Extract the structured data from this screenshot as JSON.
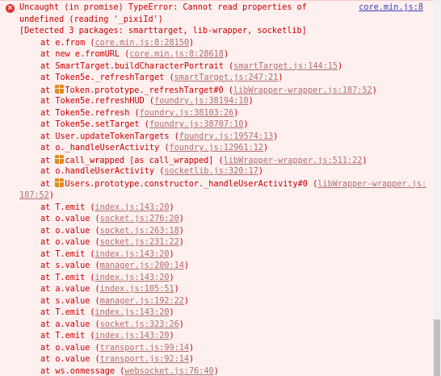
{
  "console": {
    "error_icon": "error-x-icon",
    "source_link": "core.min.js:8",
    "header_line1": "Uncaught (in promise) TypeError: Cannot read properties of",
    "header_line2": "undefined (reading '_pixiId')",
    "detected": "[Detected 3 packages: smarttarget, lib-wrapper, socketlib]",
    "frames": [
      {
        "pre": "at e.from (",
        "ref": "core.min.js:8:28150",
        "post": ")",
        "pkg": false
      },
      {
        "pre": "at new e.fromURL (",
        "ref": "core.min.js:8:28618",
        "post": ")",
        "pkg": false
      },
      {
        "pre": "at SmartTarget.buildCharacterPortrait (",
        "ref": "smartTarget.js:144:15",
        "post": ")",
        "pkg": false
      },
      {
        "pre": "at Token5e._refreshTarget (",
        "ref": "smartTarget.js:247:21",
        "post": ")",
        "pkg": false
      },
      {
        "pre": "at ",
        "pre2": "Token.prototype._refreshTarget#0 (",
        "ref": "libWrapper-wrapper.js:187:52",
        "post": ")",
        "pkg": true
      },
      {
        "pre": "at Token5e.refreshHUD (",
        "ref": "foundry.js:38194:10",
        "post": ")",
        "pkg": false
      },
      {
        "pre": "at Token5e.refresh (",
        "ref": "foundry.js:38103:26",
        "post": ")",
        "pkg": false
      },
      {
        "pre": "at Token5e.setTarget (",
        "ref": "foundry.js:38707:10",
        "post": ")",
        "pkg": false
      },
      {
        "pre": "at User.updateTokenTargets (",
        "ref": "foundry.js:19574:13",
        "post": ")",
        "pkg": false
      },
      {
        "pre": "at o._handleUserActivity (",
        "ref": "foundry.js:12961:12",
        "post": ")",
        "pkg": false
      },
      {
        "pre": "at ",
        "pre2": "call_wrapped [as call_wrapped] (",
        "ref": "libWrapper-wrapper.js:511:22",
        "post": ")",
        "pkg": true
      },
      {
        "pre": "at o.handleUserActivity (",
        "ref": "socketlib.js:320:17",
        "post": ")",
        "pkg": false
      },
      {
        "pre": "at ",
        "pre2": "Users.prototype.constructor._handleUserActivity#0 (",
        "ref": "libWrapper-wrapper.js:187:52",
        "post": ")",
        "pkg": true,
        "wrap": true
      },
      {
        "pre": "at T.emit (",
        "ref": "index.js:143:20",
        "post": ")",
        "pkg": false
      },
      {
        "pre": "at o.value (",
        "ref": "socket.js:276:20",
        "post": ")",
        "pkg": false
      },
      {
        "pre": "at o.value (",
        "ref": "socket.js:263:18",
        "post": ")",
        "pkg": false
      },
      {
        "pre": "at o.value (",
        "ref": "socket.js:231:22",
        "post": ")",
        "pkg": false
      },
      {
        "pre": "at T.emit (",
        "ref": "index.js:143:20",
        "post": ")",
        "pkg": false
      },
      {
        "pre": "at s.value (",
        "ref": "manager.js:200:14",
        "post": ")",
        "pkg": false
      },
      {
        "pre": "at T.emit (",
        "ref": "index.js:143:20",
        "post": ")",
        "pkg": false
      },
      {
        "pre": "at a.value (",
        "ref": "index.js:105:51",
        "post": ")",
        "pkg": false
      },
      {
        "pre": "at s.value (",
        "ref": "manager.js:192:22",
        "post": ")",
        "pkg": false
      },
      {
        "pre": "at T.emit (",
        "ref": "index.js:143:20",
        "post": ")",
        "pkg": false
      },
      {
        "pre": "at a.value (",
        "ref": "socket.js:323:26",
        "post": ")",
        "pkg": false
      },
      {
        "pre": "at T.emit (",
        "ref": "index.js:143:20",
        "post": ")",
        "pkg": false
      },
      {
        "pre": "at o.value (",
        "ref": "transport.js:99:14",
        "post": ")",
        "pkg": false
      },
      {
        "pre": "at o.value (",
        "ref": "transport.js:92:14",
        "post": ")",
        "pkg": false
      },
      {
        "pre": "at ws.onmessage (",
        "ref": "websocket.js:76:40",
        "post": ")",
        "pkg": false
      }
    ]
  }
}
